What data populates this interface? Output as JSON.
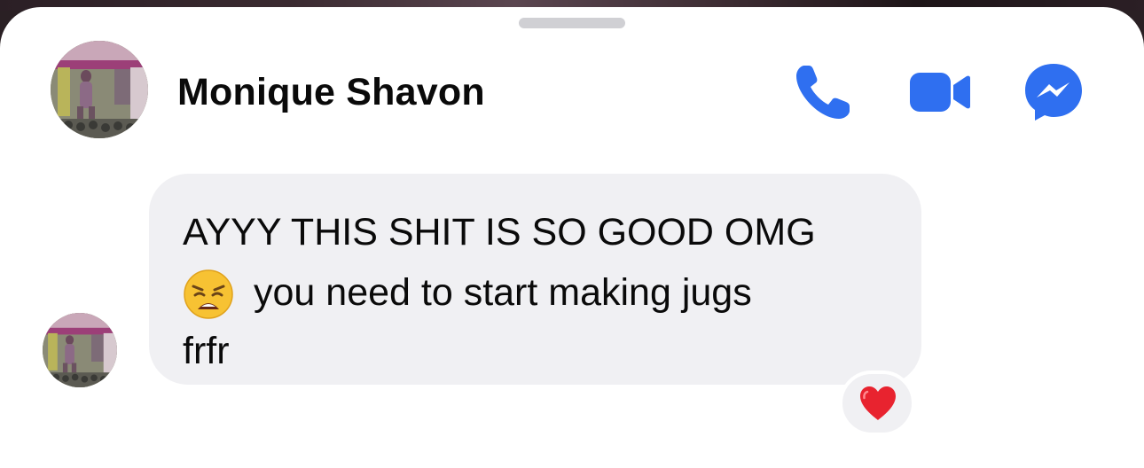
{
  "contact": {
    "name": "Monique Shavon",
    "avatar_icon": "profile-photo"
  },
  "actions": {
    "call_icon": "phone-icon",
    "video_icon": "video-camera-icon",
    "messenger_icon": "messenger-icon",
    "accent_color": "#2f6ff0"
  },
  "message": {
    "line1": "AYYY THIS SHIT IS SO GOOD OMG",
    "emoji": "weary-face-emoji",
    "line2": "you need to start making jugs",
    "line3": "frfr",
    "bubble_color": "#f0f0f3"
  },
  "reaction": {
    "icon": "red-heart-emoji",
    "color": "#e8232f"
  }
}
